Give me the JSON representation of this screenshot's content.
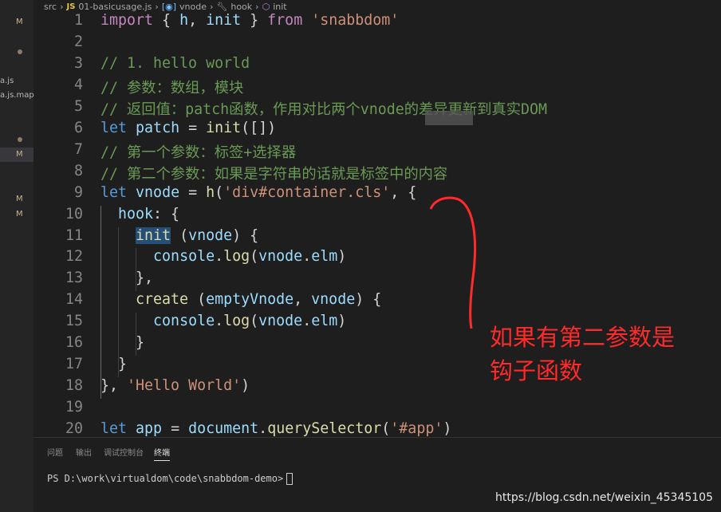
{
  "sidebar": {
    "badges": [
      "M",
      "M",
      "M",
      "M"
    ],
    "files": [
      "a.js",
      "a.js.map"
    ]
  },
  "breadcrumb": [
    "src",
    "01-basicusage.js",
    "vnode",
    "hook",
    "init"
  ],
  "breadcrumb_js_label": "JS",
  "code": [
    [
      [
        "import",
        "kw"
      ],
      [
        " { ",
        "p"
      ],
      [
        "h",
        "id"
      ],
      [
        ", ",
        "p"
      ],
      [
        "init",
        "id"
      ],
      [
        " } ",
        "p"
      ],
      [
        "from",
        "kw"
      ],
      [
        " ",
        "p"
      ],
      [
        "'snabbdom'",
        "str"
      ]
    ],
    [],
    [
      [
        "// 1. hello world",
        "cm"
      ]
    ],
    [
      [
        "// 参数：数组，模块",
        "cm"
      ]
    ],
    [
      [
        "// 返回值：patch函数，作用对比两个vnode的差异更新到真实DOM",
        "cm"
      ]
    ],
    [
      [
        "let",
        "st"
      ],
      [
        " ",
        "p"
      ],
      [
        "patch",
        "id"
      ],
      [
        " = ",
        "p"
      ],
      [
        "init",
        "fn"
      ],
      [
        "([])",
        "p"
      ]
    ],
    [
      [
        "// 第一个参数：标签+选择器",
        "cm"
      ]
    ],
    [
      [
        "// 第二个参数：如果是字符串的话就是标签中的内容",
        "cm"
      ]
    ],
    [
      [
        "let",
        "st"
      ],
      [
        " ",
        "p"
      ],
      [
        "vnode",
        "id"
      ],
      [
        " = ",
        "p"
      ],
      [
        "h",
        "fn"
      ],
      [
        "(",
        "p"
      ],
      [
        "'div#container.cls'",
        "str"
      ],
      [
        ", {",
        "p"
      ]
    ],
    [
      [
        "  ",
        "p"
      ],
      [
        "hook",
        "id"
      ],
      [
        ": {",
        "p"
      ]
    ],
    [
      [
        "    ",
        "p"
      ],
      [
        "init",
        "fn hl"
      ],
      [
        " (",
        "p"
      ],
      [
        "vnode",
        "id"
      ],
      [
        ") {",
        "p"
      ]
    ],
    [
      [
        "      ",
        "p"
      ],
      [
        "console",
        "id"
      ],
      [
        ".",
        "p"
      ],
      [
        "log",
        "fn"
      ],
      [
        "(",
        "p"
      ],
      [
        "vnode",
        "id"
      ],
      [
        ".",
        "p"
      ],
      [
        "elm",
        "id"
      ],
      [
        ")",
        "p"
      ]
    ],
    [
      [
        "    },",
        "p"
      ]
    ],
    [
      [
        "    ",
        "p"
      ],
      [
        "create",
        "fn"
      ],
      [
        " (",
        "p"
      ],
      [
        "emptyVnode",
        "id"
      ],
      [
        ", ",
        "p"
      ],
      [
        "vnode",
        "id"
      ],
      [
        ") {",
        "p"
      ]
    ],
    [
      [
        "      ",
        "p"
      ],
      [
        "console",
        "id"
      ],
      [
        ".",
        "p"
      ],
      [
        "log",
        "fn"
      ],
      [
        "(",
        "p"
      ],
      [
        "vnode",
        "id"
      ],
      [
        ".",
        "p"
      ],
      [
        "elm",
        "id"
      ],
      [
        ")",
        "p"
      ]
    ],
    [
      [
        "    }",
        "p"
      ]
    ],
    [
      [
        "  }",
        "p"
      ]
    ],
    [
      [
        "}, ",
        "p"
      ],
      [
        "'Hello World'",
        "str"
      ],
      [
        ")",
        "p"
      ]
    ],
    [],
    [
      [
        "let",
        "st"
      ],
      [
        " ",
        "p"
      ],
      [
        "app",
        "id"
      ],
      [
        " = ",
        "p"
      ],
      [
        "document",
        "id"
      ],
      [
        ".",
        "p"
      ],
      [
        "querySelector",
        "fn"
      ],
      [
        "(",
        "p"
      ],
      [
        "'#app'",
        "str"
      ],
      [
        ")",
        "p"
      ]
    ]
  ],
  "panel": {
    "tabs": [
      "问题",
      "输出",
      "调试控制台",
      "终端"
    ],
    "active_tab": "终端",
    "terminal_prompt": "PS D:\\work\\virtualdom\\code\\snabbdom-demo>"
  },
  "annotation": {
    "line1": "如果有第二参数是",
    "line2": "钩子函数",
    "color": "#ff2a2a"
  },
  "watermark": "https://blog.csdn.net/weixin_45345105"
}
